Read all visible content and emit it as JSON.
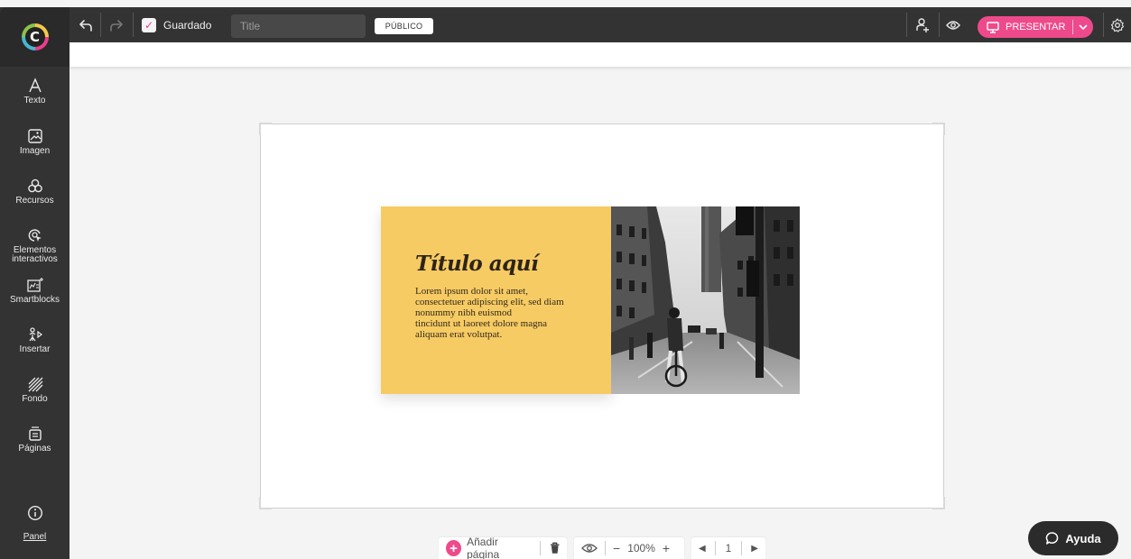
{
  "app": {
    "logo_letter": "C",
    "accent_color": "#ee4a8b"
  },
  "toolbar": {
    "undo_icon": "undo-icon",
    "redo_icon": "redo-icon",
    "saved_label": "Guardado",
    "title_placeholder": "Title",
    "public_label": "PÚBLICO",
    "add_user_icon": "add-user-icon",
    "preview_icon": "eye-icon",
    "present_label": "PRESENTAR",
    "settings_icon": "gear-icon"
  },
  "sidebar": {
    "items": [
      {
        "label": "Texto",
        "icon": "text-icon"
      },
      {
        "label": "Imagen",
        "icon": "image-icon"
      },
      {
        "label": "Recursos",
        "icon": "resources-icon"
      },
      {
        "label": "Elementos interactivos",
        "icon": "interactive-icon"
      },
      {
        "label": "Smartblocks",
        "icon": "smartblocks-icon"
      },
      {
        "label": "Insertar",
        "icon": "insert-icon"
      },
      {
        "label": "Fondo",
        "icon": "background-icon"
      },
      {
        "label": "Páginas",
        "icon": "pages-icon"
      }
    ],
    "info_icon": "info-icon",
    "panel_label": "Panel"
  },
  "slide": {
    "title": "Título aquí",
    "body_lines": [
      "Lorem ipsum dolor sit amet,",
      "consectetuer adipiscing elit, sed diam",
      "nonummy nibh euismod",
      "tincidunt ut laoreet dolore magna",
      "aliquam erat volutpat."
    ],
    "card_color": "#f6cb63",
    "photo": "black-and-white city street with cyclist"
  },
  "bottom_bar": {
    "add_page_label": "Añadir página",
    "trash_icon": "trash-icon",
    "eye_icon": "eye-icon",
    "zoom_minus": "−",
    "zoom_value": "100%",
    "zoom_plus": "+",
    "page_number": "1"
  },
  "help": {
    "label": "Ayuda",
    "icon": "chat-bubble-icon"
  }
}
